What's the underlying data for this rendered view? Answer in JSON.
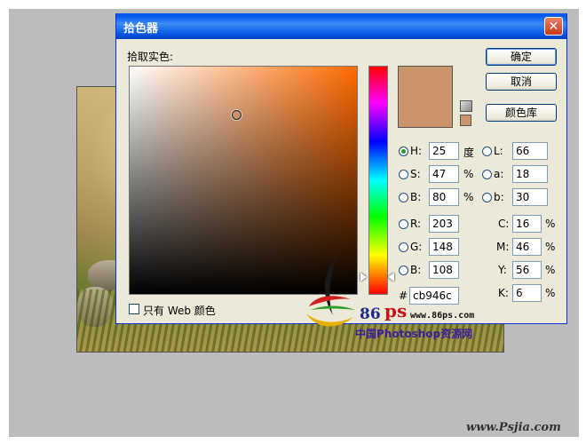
{
  "dialog": {
    "title": "拾色器",
    "close_glyph": "✕",
    "pick_label": "拾取实色:",
    "buttons": {
      "ok": "确定",
      "cancel": "取消",
      "library": "颜色库"
    },
    "current_color": "#cb946c",
    "hsb": {
      "h": {
        "label": "H:",
        "value": "25",
        "unit": "度",
        "selected": true
      },
      "s": {
        "label": "S:",
        "value": "47",
        "unit": "%"
      },
      "b": {
        "label": "B:",
        "value": "80",
        "unit": "%"
      }
    },
    "lab": {
      "l": {
        "label": "L:",
        "value": "66"
      },
      "a": {
        "label": "a:",
        "value": "18"
      },
      "b": {
        "label": "b:",
        "value": "30"
      }
    },
    "rgb": {
      "r": {
        "label": "R:",
        "value": "203"
      },
      "g": {
        "label": "G:",
        "value": "148"
      },
      "b": {
        "label": "B:",
        "value": "108"
      }
    },
    "cmyk": {
      "c": {
        "label": "C:",
        "value": "16",
        "unit": "%"
      },
      "m": {
        "label": "M:",
        "value": "46",
        "unit": "%"
      },
      "y": {
        "label": "Y:",
        "value": "56",
        "unit": "%"
      },
      "k": {
        "label": "K:",
        "value": "6",
        "unit": "%"
      }
    },
    "hex": {
      "label": "#",
      "value": "cb946c"
    },
    "web_only_label": "只有 Web 颜色"
  },
  "watermark": {
    "num": "86",
    "ps": "ps",
    "url1": "www.86ps.com",
    "cn_text": "中国Photoshop资源网",
    "url2": "www.Psjia.com"
  }
}
